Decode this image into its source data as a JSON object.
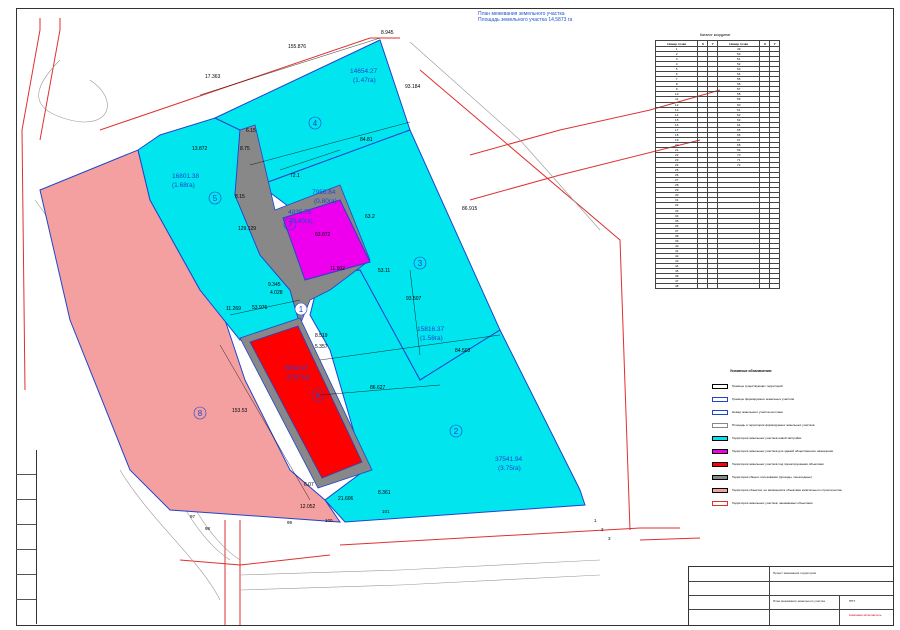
{
  "sheet": {
    "title_line1": "План межевания земельного участка",
    "title_line2": "Площадь земельного участка 14,5873 га"
  },
  "plots": [
    {
      "id": "1",
      "area": "",
      "ha": ""
    },
    {
      "id": "2",
      "area": "37541.94",
      "ha": "(3.75га)"
    },
    {
      "id": "3",
      "area": "15816.37",
      "ha": "(1.58га)"
    },
    {
      "id": "4",
      "area": "14654.27",
      "ha": "(1.47га)"
    },
    {
      "id": "5",
      "area": "16801.38",
      "ha": "(1.68га)"
    },
    {
      "id": "6",
      "area": "6662.97",
      "ha": "(0.67га)"
    },
    {
      "id": "7",
      "area": "4035.76",
      "ha": "(0.40га)"
    },
    {
      "id": "8",
      "area": "",
      "ha": ""
    }
  ],
  "corridor_label": {
    "area": "7956.84",
    "ha": "(0.80га)"
  },
  "dimensions": [
    "155.876",
    "8.945",
    "17.363",
    "93.184",
    "86.915",
    "84.81",
    "72.1",
    "8.15",
    "6.15",
    "13.872",
    "8.75",
    "129.129",
    "63.872",
    "63.2",
    "11.502",
    "53.11",
    "93.507",
    "9.345",
    "4.028",
    "11.269",
    "53.976",
    "8.519",
    "5.357",
    "84.503",
    "86.627",
    "153.53",
    "12.052",
    "21.606",
    "8.361",
    "6.07"
  ],
  "points": [
    "97",
    "98",
    "99",
    "100",
    "101",
    "1",
    "2",
    "3"
  ],
  "coord_table": {
    "title": "Каталог координат",
    "headers": [
      "Номер точки",
      "X",
      "Y",
      "Номер точки",
      "X",
      "Y"
    ],
    "rows": [
      [
        "1",
        "",
        "",
        "49",
        "",
        ""
      ],
      [
        "2",
        "",
        "",
        "50",
        "",
        ""
      ],
      [
        "3",
        "",
        "",
        "51",
        "",
        ""
      ],
      [
        "4",
        "",
        "",
        "52",
        "",
        ""
      ],
      [
        "5",
        "",
        "",
        "53",
        "",
        ""
      ],
      [
        "6",
        "",
        "",
        "54",
        "",
        ""
      ],
      [
        "7",
        "",
        "",
        "55",
        "",
        ""
      ],
      [
        "8",
        "",
        "",
        "56",
        "",
        ""
      ],
      [
        "9",
        "",
        "",
        "57",
        "",
        ""
      ],
      [
        "10",
        "",
        "",
        "58",
        "",
        ""
      ],
      [
        "11",
        "",
        "",
        "59",
        "",
        ""
      ],
      [
        "12",
        "",
        "",
        "60",
        "",
        ""
      ],
      [
        "13",
        "",
        "",
        "61",
        "",
        ""
      ],
      [
        "14",
        "",
        "",
        "62",
        "",
        ""
      ],
      [
        "15",
        "",
        "",
        "63",
        "",
        ""
      ],
      [
        "16",
        "",
        "",
        "64",
        "",
        ""
      ],
      [
        "17",
        "",
        "",
        "65",
        "",
        ""
      ],
      [
        "18",
        "",
        "",
        "66",
        "",
        ""
      ],
      [
        "19",
        "",
        "",
        "67",
        "",
        ""
      ],
      [
        "20",
        "",
        "",
        "68",
        "",
        ""
      ],
      [
        "21",
        "",
        "",
        "69",
        "",
        ""
      ],
      [
        "22",
        "",
        "",
        "70",
        "",
        ""
      ],
      [
        "23",
        "",
        "",
        "71",
        "",
        ""
      ],
      [
        "24",
        "",
        "",
        "72",
        "",
        ""
      ],
      [
        "25",
        "",
        "",
        "",
        "",
        ""
      ],
      [
        "26",
        "",
        "",
        "",
        "",
        ""
      ],
      [
        "27",
        "",
        "",
        "",
        "",
        ""
      ],
      [
        "28",
        "",
        "",
        "",
        "",
        ""
      ],
      [
        "29",
        "",
        "",
        "",
        "",
        ""
      ],
      [
        "30",
        "",
        "",
        "",
        "",
        ""
      ],
      [
        "31",
        "",
        "",
        "",
        "",
        ""
      ],
      [
        "32",
        "",
        "",
        "",
        "",
        ""
      ],
      [
        "33",
        "",
        "",
        "",
        "",
        ""
      ],
      [
        "34",
        "",
        "",
        "",
        "",
        ""
      ],
      [
        "35",
        "",
        "",
        "",
        "",
        ""
      ],
      [
        "36",
        "",
        "",
        "",
        "",
        ""
      ],
      [
        "37",
        "",
        "",
        "",
        "",
        ""
      ],
      [
        "38",
        "",
        "",
        "",
        "",
        ""
      ],
      [
        "39",
        "",
        "",
        "",
        "",
        ""
      ],
      [
        "40",
        "",
        "",
        "",
        "",
        ""
      ],
      [
        "41",
        "",
        "",
        "",
        "",
        ""
      ],
      [
        "42",
        "",
        "",
        "",
        "",
        ""
      ],
      [
        "43",
        "",
        "",
        "",
        "",
        ""
      ],
      [
        "44",
        "",
        "",
        "",
        "",
        ""
      ],
      [
        "45",
        "",
        "",
        "",
        "",
        ""
      ],
      [
        "46",
        "",
        "",
        "",
        "",
        ""
      ],
      [
        "47",
        "",
        "",
        "",
        "",
        ""
      ],
      [
        "48",
        "",
        "",
        "",
        "",
        ""
      ]
    ]
  },
  "legend": {
    "title": "Условные обозначения:",
    "items": [
      {
        "color": "#ffffff",
        "border": "#000000",
        "text": "Границы существующих территорий"
      },
      {
        "color": "#ffffff",
        "border": "#2244cc",
        "text": "Границы формируемых земельных участков"
      },
      {
        "color": "#ffffff",
        "border": "#2244cc",
        "text": "Номер земельного участка на плане"
      },
      {
        "color": "#ffffff",
        "border": "#888888",
        "text": "Площадь и территория формируемых земельных участков"
      },
      {
        "color": "#00e5ee",
        "border": "#000000",
        "text": "Территория земельных участков новой застройки"
      },
      {
        "color": "#ee00ee",
        "border": "#000000",
        "text": "Территория земельных участков для зданий общественного назначения"
      },
      {
        "color": "#ff0000",
        "border": "#000000",
        "text": "Территория земельных участков под проектируемыми объектами"
      },
      {
        "color": "#888888",
        "border": "#000000",
        "text": "Территория общего пользования (проезды, пешеходные)"
      },
      {
        "color": "#f4a0a0",
        "border": "#000000",
        "text": "Территория объектов, не являющихся объектами капитального строительства"
      },
      {
        "color": "#ffffff",
        "border": "#e03030",
        "text": "Территория земельных участков, занимаемых объектами"
      }
    ]
  },
  "title_block": {
    "project": "Проект межевания территории",
    "sheet_name": "План межевания земельного участка",
    "stage": "ППТ",
    "org": "Компания-исполнитель"
  },
  "colors": {
    "cyan": "#00e5ee",
    "magenta": "#ee00ee",
    "red": "#ff0000",
    "salmon": "#f4a0a0",
    "gray": "#888888",
    "blue_line": "#2244cc",
    "red_line": "#e03030"
  }
}
